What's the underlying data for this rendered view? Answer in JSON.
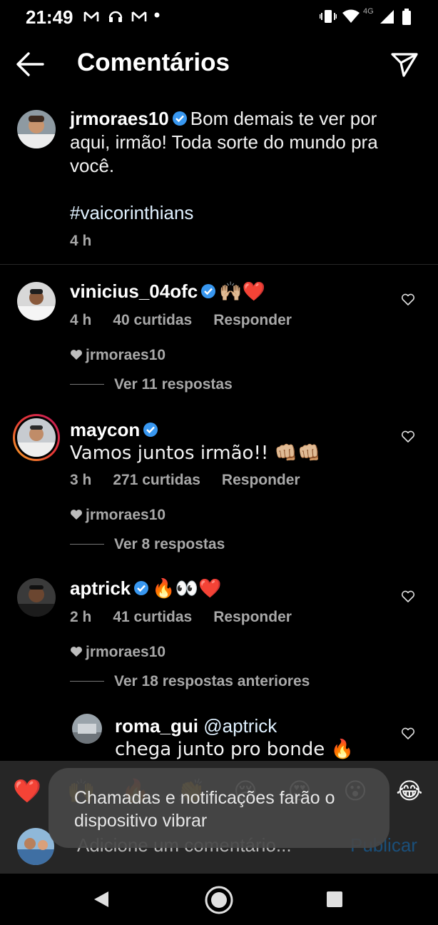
{
  "status": {
    "time": "21:49",
    "network": "4G"
  },
  "header": {
    "title": "Comentários"
  },
  "caption": {
    "username": "jrmoraes10",
    "text": "Bom demais te ver por aqui, irmão! Toda sorte do mundo pra você.",
    "hashtag": "#vaicorinthians",
    "time": "4 h"
  },
  "comments": [
    {
      "username": "vinicius_04ofc",
      "text": "🙌🏼❤️",
      "time": "4 h",
      "likes": "40 curtidas",
      "reply": "Responder",
      "liked_by": "jrmoraes10",
      "replies": "Ver 11 respostas"
    },
    {
      "username": "maycon",
      "text": "Vamos juntos irmão!! 👊🏼👊🏼",
      "time": "3 h",
      "likes": "271 curtidas",
      "reply": "Responder",
      "liked_by": "jrmoraes10",
      "replies": "Ver 8 respostas"
    },
    {
      "username": "aptrick",
      "text": "🔥👀❤️",
      "time": "2 h",
      "likes": "41 curtidas",
      "reply": "Responder",
      "liked_by": "jrmoraes10",
      "replies": "Ver 18 respostas anteriores"
    }
  ],
  "reply": {
    "username": "roma_gui",
    "mention": "@aptrick",
    "text": "chega junto pro bonde 🔥"
  },
  "composer": {
    "emojis": [
      "❤️",
      "🙌",
      "🔥",
      "👏",
      "😢",
      "😍",
      "😮",
      "😂"
    ],
    "placeholder": "Adicione um comentário...",
    "publish": "Publicar"
  },
  "toast": {
    "text": "Chamadas e notificações farão o dispositivo vibrar"
  },
  "colors": {
    "background": "#000000",
    "verified": "#3897f0",
    "muted": "#a8a8a8",
    "publish": "#1a4f7a"
  }
}
